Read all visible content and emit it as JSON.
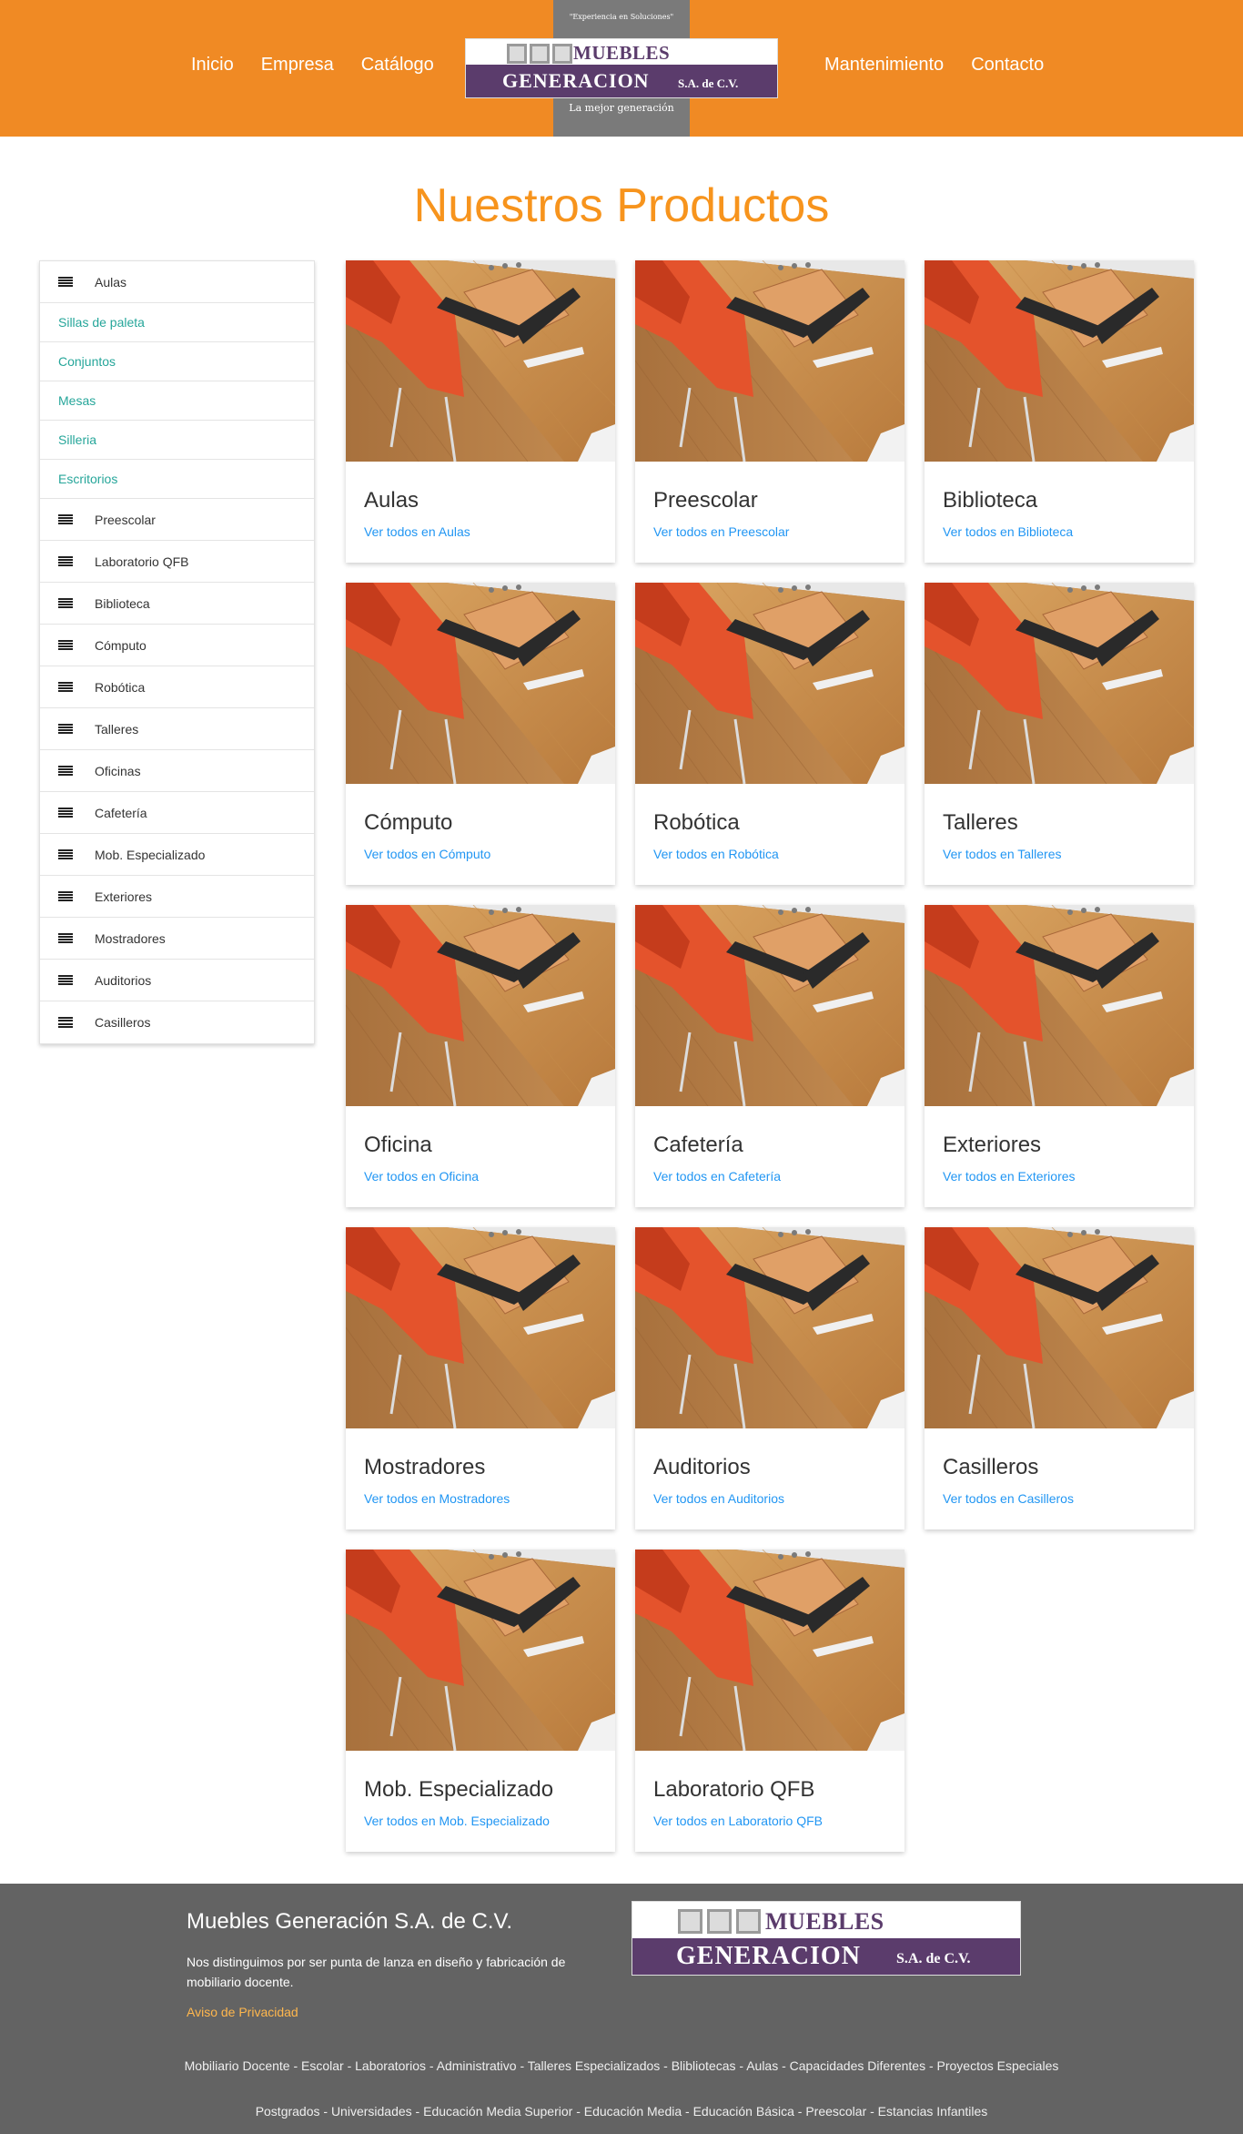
{
  "header": {
    "nav_left": [
      "Inicio",
      "Empresa",
      "Catálogo"
    ],
    "nav_right": [
      "Mantenimiento",
      "Contacto"
    ],
    "logo_slogan": "\"Experiencia en Soluciones\"",
    "logo_tagline": "La mejor generación",
    "logo_word_1": "MUEBLES",
    "logo_word_2": "GENERACION",
    "logo_word_3": "S.A. de C.V."
  },
  "page_title": "Nuestros Productos",
  "sidebar": {
    "items": [
      {
        "label": "Aulas",
        "type": "parent"
      },
      {
        "label": "Sillas de paleta",
        "type": "child"
      },
      {
        "label": "Conjuntos",
        "type": "child"
      },
      {
        "label": "Mesas",
        "type": "child"
      },
      {
        "label": "Silleria",
        "type": "child"
      },
      {
        "label": "Escritorios",
        "type": "child"
      },
      {
        "label": "Preescolar",
        "type": "parent"
      },
      {
        "label": "Laboratorio QFB",
        "type": "parent"
      },
      {
        "label": "Biblioteca",
        "type": "parent"
      },
      {
        "label": "Cómputo",
        "type": "parent"
      },
      {
        "label": "Robótica",
        "type": "parent"
      },
      {
        "label": "Talleres",
        "type": "parent"
      },
      {
        "label": "Oficinas",
        "type": "parent"
      },
      {
        "label": "Cafetería",
        "type": "parent"
      },
      {
        "label": "Mob. Especializado",
        "type": "parent"
      },
      {
        "label": "Exteriores",
        "type": "parent"
      },
      {
        "label": "Mostradores",
        "type": "parent"
      },
      {
        "label": "Auditorios",
        "type": "parent"
      },
      {
        "label": "Casilleros",
        "type": "parent"
      }
    ]
  },
  "products": [
    {
      "title": "Aulas",
      "link": "Ver todos en Aulas"
    },
    {
      "title": "Preescolar",
      "link": "Ver todos en Preescolar"
    },
    {
      "title": "Biblioteca",
      "link": "Ver todos en Biblioteca"
    },
    {
      "title": "Cómputo",
      "link": "Ver todos en Cómputo"
    },
    {
      "title": "Robótica",
      "link": "Ver todos en Robótica"
    },
    {
      "title": "Talleres",
      "link": "Ver todos en Talleres"
    },
    {
      "title": "Oficina",
      "link": "Ver todos en Oficina"
    },
    {
      "title": "Cafetería",
      "link": "Ver todos en Cafetería"
    },
    {
      "title": "Exteriores",
      "link": "Ver todos en Exteriores"
    },
    {
      "title": "Mostradores",
      "link": "Ver todos en Mostradores"
    },
    {
      "title": "Auditorios",
      "link": "Ver todos en Auditorios"
    },
    {
      "title": "Casilleros",
      "link": "Ver todos en Casilleros"
    },
    {
      "title": "Mob. Especializado",
      "link": "Ver todos en Mob. Especializado"
    },
    {
      "title": "Laboratorio QFB",
      "link": "Ver todos en Laboratorio QFB"
    }
  ],
  "footer": {
    "company": "Muebles Generación S.A. de C.V.",
    "description": "Nos distinguimos por ser punta de lanza en diseño y fabricación de mobiliario docente.",
    "privacy": "Aviso de Privacidad",
    "line_1": "Mobiliario Docente - Escolar - Laboratorios - Administrativo - Talleres Especializados - Blibliotecas - Aulas - Capacidades Diferentes - Proyectos Especiales",
    "line_2": "Postgrados - Universidades - Educación Media Superior - Educación Media - Educación Básica - Preescolar - Estancias Infantiles"
  },
  "colors": {
    "header_orange": "#f08a24",
    "title_orange": "#f7941d",
    "logo_purple": "#5b3c6c",
    "teal_link": "#26a69a",
    "blue_link": "#2196f3",
    "footer_gray": "#636363",
    "privacy_link": "#ffb74d"
  }
}
